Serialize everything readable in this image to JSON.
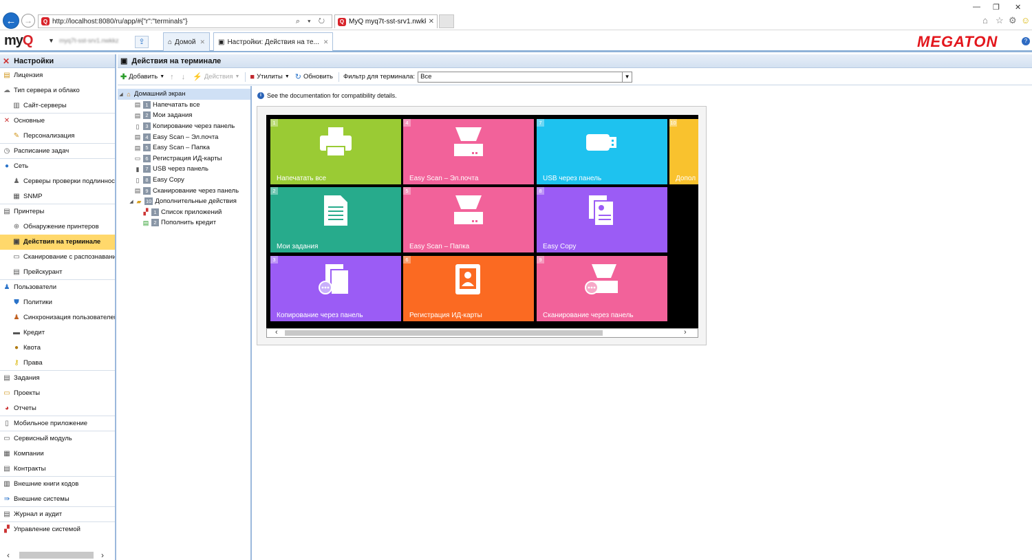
{
  "browser": {
    "address": "http://localhost:8080/ru/app/#{\"r\":\"terminals\"}",
    "tab_title": "MyQ myq7t-sst-srv1.nwkkz ...",
    "tab_close": "✕"
  },
  "header": {
    "logo_my": "my",
    "logo_q": "Q",
    "server_name": "myq7t-sst-srv1.nwkkz",
    "tabs": [
      {
        "label": "Домой",
        "close": "✕"
      },
      {
        "label": "Настройки: Действия на те...",
        "close": "✕"
      }
    ],
    "brand": "MEGATON",
    "help": "?"
  },
  "sidebar": {
    "title": "Настройки",
    "items": [
      {
        "label": "Лицензия",
        "icon": "license-icon"
      },
      {
        "label": "Тип сервера и облако",
        "icon": "cloud-icon"
      },
      {
        "label": "Сайт-серверы",
        "icon": "servers-icon"
      },
      {
        "label": "Основные",
        "icon": "tools-icon"
      },
      {
        "label": "Персонализация",
        "icon": "palette-icon"
      },
      {
        "label": "Расписание задач",
        "icon": "clock-icon"
      },
      {
        "label": "Сеть",
        "icon": "network-icon"
      },
      {
        "label": "Серверы проверки подлинности",
        "icon": "auth-server-icon"
      },
      {
        "label": "SNMP",
        "icon": "snmp-icon"
      },
      {
        "label": "Принтеры",
        "icon": "printer-icon"
      },
      {
        "label": "Обнаружение принтеров",
        "icon": "printer-discovery-icon"
      },
      {
        "label": "Действия на терминале",
        "icon": "terminal-icon"
      },
      {
        "label": "Сканирование с распознаванием",
        "icon": "scan-icon"
      },
      {
        "label": "Прейскурант",
        "icon": "pricelist-icon"
      },
      {
        "label": "Пользователи",
        "icon": "users-icon"
      },
      {
        "label": "Политики",
        "icon": "shield-icon"
      },
      {
        "label": "Синхронизация пользователей",
        "icon": "sync-icon"
      },
      {
        "label": "Кредит",
        "icon": "credit-icon"
      },
      {
        "label": "Квота",
        "icon": "quota-icon"
      },
      {
        "label": "Права",
        "icon": "key-icon"
      },
      {
        "label": "Задания",
        "icon": "jobs-icon"
      },
      {
        "label": "Проекты",
        "icon": "projects-icon"
      },
      {
        "label": "Отчеты",
        "icon": "reports-icon"
      },
      {
        "label": "Мобильное приложение",
        "icon": "mobile-icon"
      },
      {
        "label": "Сервисный модуль",
        "icon": "service-icon"
      },
      {
        "label": "Компании",
        "icon": "companies-icon"
      },
      {
        "label": "Контракты",
        "icon": "contracts-icon"
      },
      {
        "label": "Внешние книги кодов",
        "icon": "codebook-icon"
      },
      {
        "label": "Внешние системы",
        "icon": "external-icon"
      },
      {
        "label": "Журнал и аудит",
        "icon": "log-icon"
      },
      {
        "label": "Управление системой",
        "icon": "system-icon"
      }
    ]
  },
  "main": {
    "title": "Действия на терминале",
    "toolbar": {
      "add": "Добавить",
      "actions": "Действия",
      "utilities": "Утилиты",
      "refresh": "Обновить",
      "filter_label": "Фильтр для терминала:",
      "filter_value": "Все"
    },
    "tree": {
      "root": "Домашний экран",
      "items": [
        {
          "num": "1",
          "label": "Напечатать все"
        },
        {
          "num": "2",
          "label": "Мои задания"
        },
        {
          "num": "3",
          "label": "Копирование через панель"
        },
        {
          "num": "4",
          "label": "Easy Scan – Эл.почта"
        },
        {
          "num": "5",
          "label": "Easy Scan – Папка"
        },
        {
          "num": "6",
          "label": "Регистрация ИД-карты"
        },
        {
          "num": "7",
          "label": "USB через панель"
        },
        {
          "num": "8",
          "label": "Easy Copy"
        },
        {
          "num": "9",
          "label": "Сканирование через панель"
        },
        {
          "num": "10",
          "label": "Дополнительные действия"
        }
      ],
      "subitems": [
        {
          "num": "1",
          "label": "Список приложений"
        },
        {
          "num": "2",
          "label": "Пополнить кредит"
        }
      ]
    },
    "info": "See the documentation for compatibility details.",
    "tiles": [
      {
        "num": "1",
        "label": "Напечатать все",
        "color": "#9acb34",
        "icon": "printer-icon"
      },
      {
        "num": "4",
        "label": "Easy Scan – Эл.почта",
        "color": "#f2629a",
        "icon": "scanner-icon"
      },
      {
        "num": "7",
        "label": "USB через панель",
        "color": "#1ec2ef",
        "icon": "usb-icon"
      },
      {
        "num": "10",
        "label": "Допол",
        "color": "#f9c22e",
        "icon": ""
      },
      {
        "num": "2",
        "label": "Мои задания",
        "color": "#27ab8c",
        "icon": "document-icon"
      },
      {
        "num": "5",
        "label": "Easy Scan – Папка",
        "color": "#f2629a",
        "icon": "scanner-icon"
      },
      {
        "num": "8",
        "label": "Easy Copy",
        "color": "#9b5cf5",
        "icon": "copy-icon"
      },
      {
        "num": "3",
        "label": "Копирование через панель",
        "color": "#9b5cf5",
        "icon": "copy-panel-icon"
      },
      {
        "num": "6",
        "label": "Регистрация ИД-карты",
        "color": "#fb6a22",
        "icon": "id-card-icon"
      },
      {
        "num": "9",
        "label": "Сканирование через панель",
        "color": "#f2629a",
        "icon": "scanner-panel-icon"
      }
    ]
  }
}
